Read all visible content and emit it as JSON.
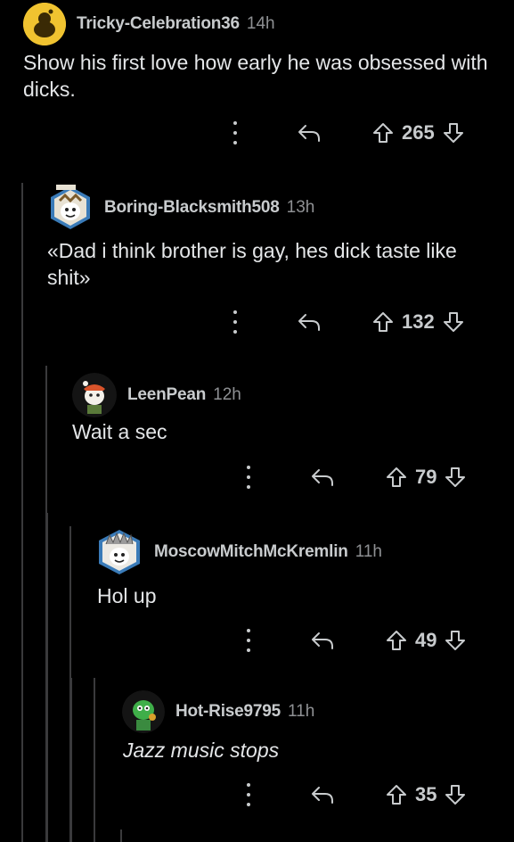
{
  "comments": [
    {
      "username": "Tricky-Celebration36",
      "time": "14h",
      "body": "Show his first love how early he was obsessed with dicks.",
      "score": "265"
    },
    {
      "username": "Boring-Blacksmith508",
      "time": "13h",
      "body": "«Dad i think brother is gay, hes dick taste like shit»",
      "score": "132"
    },
    {
      "username": "LeenPean",
      "time": "12h",
      "body": "Wait a sec",
      "score": "79"
    },
    {
      "username": "MoscowMitchMcKremlin",
      "time": "11h",
      "body": "Hol up",
      "score": "49"
    },
    {
      "username": "Hot-Rise9795",
      "time": "11h",
      "body": "Jazz music stops",
      "score": "35"
    }
  ],
  "colors": {
    "background": "#000000",
    "text": "#e4e6e8",
    "meta": "#8e9093",
    "thread_line": "#3a3a3c",
    "avatar_default": "#f0c330"
  },
  "icons": [
    "more-icon",
    "reply-icon",
    "upvote-icon",
    "downvote-icon"
  ]
}
